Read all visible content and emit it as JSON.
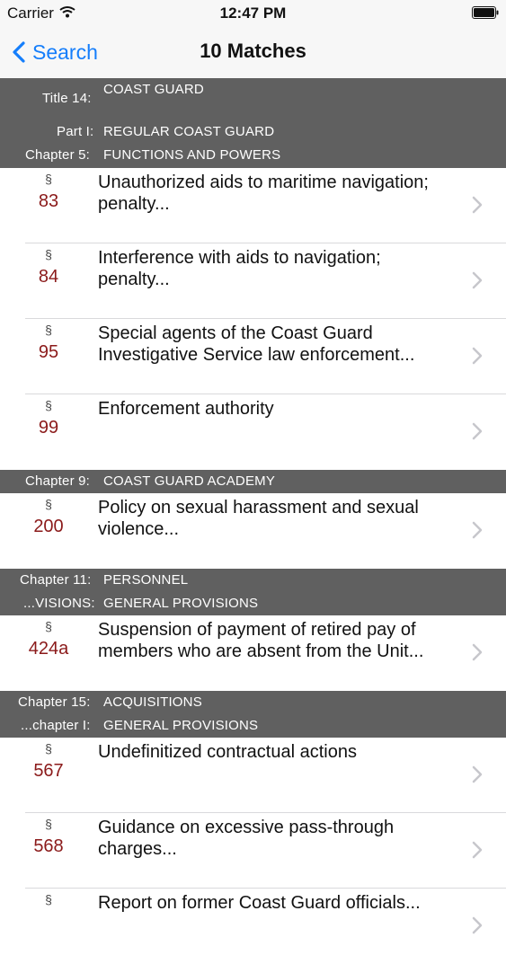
{
  "status_bar": {
    "carrier": "Carrier",
    "time": "12:47 PM"
  },
  "nav": {
    "back_label": "Search",
    "title": "10 Matches"
  },
  "groups": [
    {
      "header": [
        {
          "label": "Title 14:",
          "value": "COAST GUARD"
        },
        {
          "label": "Part I:",
          "value": "REGULAR COAST GUARD"
        },
        {
          "label": "Chapter 5:",
          "value": "FUNCTIONS AND POWERS"
        }
      ],
      "items": [
        {
          "symbol": "§",
          "number": "83",
          "title": "Unauthorized aids to maritime navigation; penalty..."
        },
        {
          "symbol": "§",
          "number": "84",
          "title": "Interference with aids to navigation; penalty..."
        },
        {
          "symbol": "§",
          "number": "95",
          "title": "Special agents of the Coast Guard Investigative Service law enforcement..."
        },
        {
          "symbol": "§",
          "number": "99",
          "title": "Enforcement authority"
        }
      ]
    },
    {
      "header": [
        {
          "label": "Chapter 9:",
          "value": "COAST GUARD ACADEMY"
        }
      ],
      "items": [
        {
          "symbol": "§",
          "number": "200",
          "title": "Policy on sexual harassment and sexual violence..."
        }
      ]
    },
    {
      "header": [
        {
          "label": "Chapter 11:",
          "value": "PERSONNEL"
        },
        {
          "label": "...VISIONS:",
          "value": "GENERAL PROVISIONS"
        }
      ],
      "items": [
        {
          "symbol": "§",
          "number": "424a",
          "title": "Suspension of payment of retired pay of members who are absent from the Unit..."
        }
      ]
    },
    {
      "header": [
        {
          "label": "Chapter 15:",
          "value": "ACQUISITIONS"
        },
        {
          "label": "...chapter I:",
          "value": "GENERAL PROVISIONS"
        }
      ],
      "items": [
        {
          "symbol": "§",
          "number": "567",
          "title": "Undefinitized contractual actions"
        },
        {
          "symbol": "§",
          "number": "568",
          "title": "Guidance on excessive pass-through charges..."
        },
        {
          "symbol": "§",
          "number": "",
          "title": "Report on former Coast Guard officials..."
        }
      ]
    }
  ],
  "colors": {
    "accent": "#157efb",
    "header_bg": "#606060",
    "section_number": "#8b1a1a",
    "separator": "#d9d9dc"
  },
  "icons": {
    "back": "chevron-left-icon",
    "row": "chevron-right-icon",
    "wifi": "wifi-icon",
    "battery": "battery-icon"
  }
}
